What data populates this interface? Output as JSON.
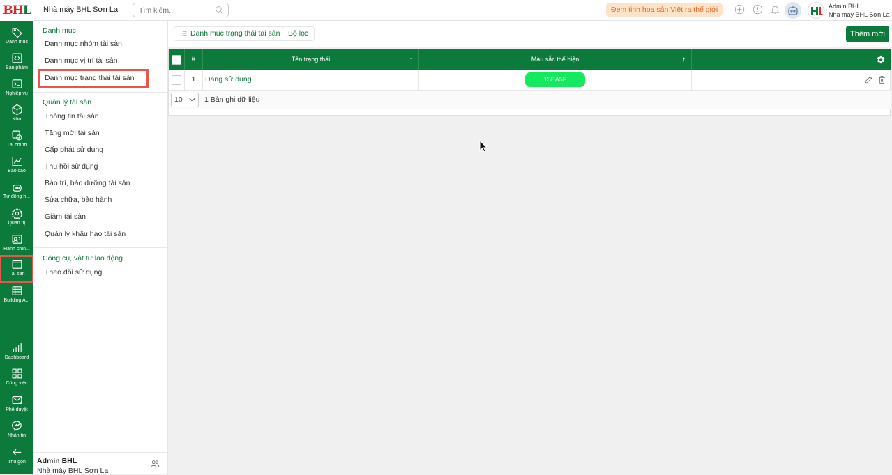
{
  "logo": {
    "text_red": "BH",
    "text_green": "L"
  },
  "rail": {
    "items": [
      {
        "label": "Danh mục",
        "icon": "tag-icon"
      },
      {
        "label": "Sản phẩm",
        "icon": "code-box-icon"
      },
      {
        "label": "Nghiệp vụ",
        "icon": "terminal-icon"
      },
      {
        "label": "Kho",
        "icon": "cube-icon"
      },
      {
        "label": "Tài chính",
        "icon": "finance-icon"
      },
      {
        "label": "Báo cáo",
        "icon": "line-chart-icon"
      },
      {
        "label": "Tự động h...",
        "icon": "robot-icon"
      },
      {
        "label": "Quản trị",
        "icon": "gear-icon"
      },
      {
        "label": "Hành chín...",
        "icon": "id-card-icon"
      },
      {
        "label": "Tài sản",
        "icon": "asset-icon"
      },
      {
        "label": "Building A...",
        "icon": "building-icon"
      }
    ],
    "bottom": [
      {
        "label": "Dashboard",
        "icon": "bar-chart-icon"
      },
      {
        "label": "Công việc",
        "icon": "grid-icon"
      },
      {
        "label": "Phê duyệt",
        "icon": "mail-check-icon"
      },
      {
        "label": "Nhắn tin",
        "icon": "messenger-icon"
      },
      {
        "label": "Thu gọn",
        "icon": "arrow-left-icon"
      }
    ]
  },
  "topbar": {
    "company": "Nhà máy BHL Sơn La",
    "search_placeholder": "Tìm kiếm...",
    "slogan": "Đem tinh hoa sản Việt ra thế giới",
    "user_name": "Admin BHL",
    "user_org": "Nhà máy BHL Sơn La"
  },
  "sidebar": {
    "sections": [
      {
        "title": "Danh mục",
        "items": [
          "Danh mục nhóm tài sản",
          "Danh mục vị trí tài sản",
          "Danh mục trạng thái tài sản"
        ]
      },
      {
        "title": "Quản lý tài sản",
        "items": [
          "Thông tin tài sản",
          "Tăng mới tài sản",
          "Cấp phát sử dụng",
          "Thu hồi sử dụng",
          "Bảo trì, bảo dưỡng tài sản",
          "Sửa chữa, bảo hành",
          "Giảm tài sản",
          "Quản lý khấu hao tài sản"
        ]
      },
      {
        "title": "Công cụ, vật tư lao động",
        "items": [
          "Theo dõi sử dụng"
        ]
      }
    ],
    "footer_name": "Admin BHL",
    "footer_org": "Nhà máy BHL Sơn La"
  },
  "toolbar": {
    "tab_label": "Danh mục trạng thái tài sản",
    "filter_label": "Bộ lọc",
    "add_label": "Thêm mới"
  },
  "table": {
    "headers": [
      "#",
      "Tên trạng thái",
      "Màu sắc thể hiện"
    ],
    "rows": [
      {
        "index": "1",
        "name": "Đang sử dụng",
        "color_label": "15EA5F",
        "color": "#15EA5F"
      }
    ],
    "page_size": "10",
    "records_text": "1 Bản ghi dữ liệu"
  },
  "colors": {
    "brand": "#0B7A3A",
    "highlight": "#E8564B",
    "slogan_bg": "#FDE3C7",
    "slogan_text": "#E2682E"
  }
}
